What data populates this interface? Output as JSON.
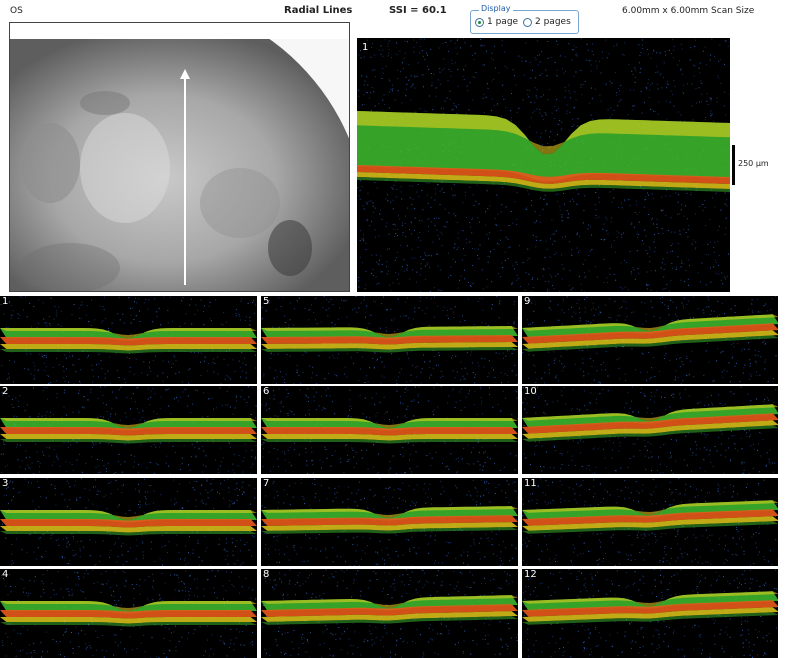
{
  "header": {
    "eye": "OS",
    "scan_type": "Radial Lines",
    "ssi": "SSI = 60.1",
    "display": {
      "legend": "Display",
      "options": [
        {
          "label": "1 page",
          "selected": true
        },
        {
          "label": "2 pages",
          "selected": false
        }
      ]
    },
    "scan_size": "6.00mm x 6.00mm Scan Size"
  },
  "main_scan": {
    "number": "1",
    "scale_label": "250 µm"
  },
  "thumbnails": [
    {
      "number": "1"
    },
    {
      "number": "2"
    },
    {
      "number": "3"
    },
    {
      "number": "4"
    },
    {
      "number": "5"
    },
    {
      "number": "6"
    },
    {
      "number": "7"
    },
    {
      "number": "8"
    },
    {
      "number": "9"
    },
    {
      "number": "10"
    },
    {
      "number": "11"
    },
    {
      "number": "12"
    }
  ],
  "colors": {
    "background": "#000000",
    "rnfl": "#3fbf2f",
    "rpe": "#e8591a",
    "outer": "#f0d41c"
  }
}
